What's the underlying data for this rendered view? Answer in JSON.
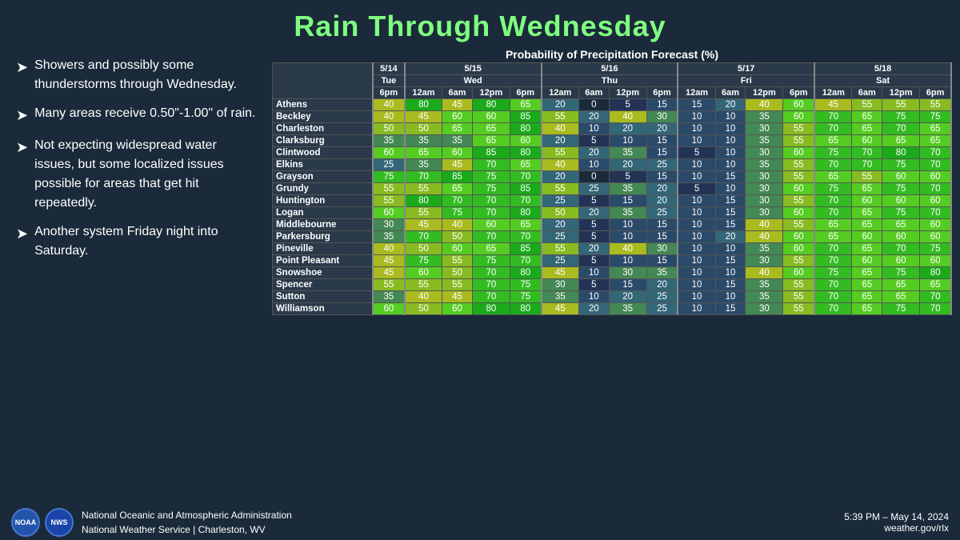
{
  "title": "Rain Through Wednesday",
  "bullets": [
    "Showers and possibly some thunderstorms through Wednesday.",
    "Many areas receive 0.50\"-1.00\" of rain.",
    "Not expecting widespread water issues, but some localized issues possible for areas that get hit repeatedly.",
    "Another system Friday night into Saturday."
  ],
  "table_title": "Probability of Precipitation Forecast (%)",
  "dates": [
    {
      "label": "5/14",
      "sub": "Tue",
      "cols": [
        "6pm"
      ]
    },
    {
      "label": "5/15",
      "sub": "Wed",
      "cols": [
        "12am",
        "6am",
        "12pm",
        "6pm"
      ]
    },
    {
      "label": "5/16",
      "sub": "Thu",
      "cols": [
        "12am",
        "6am",
        "12pm",
        "6pm"
      ]
    },
    {
      "label": "5/17",
      "sub": "Fri",
      "cols": [
        "12am",
        "6am",
        "12pm",
        "6pm"
      ]
    },
    {
      "label": "5/18",
      "sub": "Sat",
      "cols": [
        "12am",
        "6am",
        "12pm",
        "6pm"
      ]
    }
  ],
  "cities": [
    {
      "name": "Athens",
      "vals": [
        40,
        80,
        45,
        80,
        65,
        20,
        0,
        5,
        15,
        15,
        20,
        40,
        60,
        45,
        55,
        55,
        55
      ]
    },
    {
      "name": "Beckley",
      "vals": [
        40,
        45,
        60,
        60,
        85,
        55,
        20,
        40,
        30,
        10,
        10,
        35,
        60,
        70,
        65,
        75,
        75
      ]
    },
    {
      "name": "Charleston",
      "vals": [
        50,
        50,
        65,
        65,
        80,
        40,
        10,
        20,
        20,
        10,
        10,
        30,
        55,
        70,
        65,
        70,
        65
      ]
    },
    {
      "name": "Clarksburg",
      "vals": [
        35,
        35,
        35,
        65,
        60,
        20,
        5,
        10,
        15,
        10,
        10,
        35,
        55,
        65,
        60,
        65,
        65
      ]
    },
    {
      "name": "Clintwood",
      "vals": [
        60,
        65,
        60,
        85,
        80,
        55,
        20,
        35,
        15,
        5,
        10,
        30,
        60,
        75,
        70,
        80,
        70
      ]
    },
    {
      "name": "Elkins",
      "vals": [
        25,
        35,
        45,
        70,
        65,
        40,
        10,
        20,
        25,
        10,
        10,
        35,
        55,
        70,
        70,
        75,
        70
      ]
    },
    {
      "name": "Grayson",
      "vals": [
        75,
        70,
        85,
        75,
        70,
        20,
        0,
        5,
        15,
        10,
        15,
        30,
        55,
        65,
        55,
        60,
        60
      ]
    },
    {
      "name": "Grundy",
      "vals": [
        55,
        55,
        65,
        75,
        85,
        55,
        25,
        35,
        20,
        5,
        10,
        30,
        60,
        75,
        65,
        75,
        70
      ]
    },
    {
      "name": "Huntington",
      "vals": [
        55,
        80,
        70,
        70,
        70,
        25,
        5,
        15,
        20,
        10,
        15,
        30,
        55,
        70,
        60,
        60,
        60
      ]
    },
    {
      "name": "Logan",
      "vals": [
        60,
        55,
        75,
        70,
        80,
        50,
        20,
        35,
        25,
        10,
        15,
        30,
        60,
        70,
        65,
        75,
        70
      ]
    },
    {
      "name": "Middlebourne",
      "vals": [
        30,
        45,
        40,
        60,
        65,
        20,
        5,
        10,
        15,
        10,
        15,
        40,
        55,
        65,
        65,
        65,
        60
      ]
    },
    {
      "name": "Parkersburg",
      "vals": [
        35,
        70,
        50,
        70,
        70,
        25,
        5,
        10,
        15,
        10,
        20,
        40,
        60,
        65,
        60,
        60,
        60
      ]
    },
    {
      "name": "Pineville",
      "vals": [
        40,
        50,
        60,
        65,
        85,
        55,
        20,
        40,
        30,
        10,
        10,
        35,
        60,
        70,
        65,
        70,
        75
      ]
    },
    {
      "name": "Point Pleasant",
      "vals": [
        45,
        75,
        55,
        75,
        70,
        25,
        5,
        10,
        15,
        10,
        15,
        30,
        55,
        70,
        60,
        60,
        60
      ]
    },
    {
      "name": "Snowshoe",
      "vals": [
        45,
        60,
        50,
        70,
        80,
        45,
        10,
        30,
        35,
        10,
        10,
        40,
        60,
        75,
        65,
        75,
        80
      ]
    },
    {
      "name": "Spencer",
      "vals": [
        55,
        55,
        55,
        70,
        75,
        30,
        5,
        15,
        20,
        10,
        15,
        35,
        55,
        70,
        65,
        65,
        65
      ]
    },
    {
      "name": "Sutton",
      "vals": [
        35,
        40,
        45,
        70,
        75,
        35,
        10,
        20,
        25,
        10,
        10,
        35,
        55,
        70,
        65,
        65,
        70
      ]
    },
    {
      "name": "Williamson",
      "vals": [
        60,
        50,
        60,
        80,
        80,
        45,
        20,
        35,
        25,
        10,
        15,
        30,
        55,
        70,
        65,
        75,
        70
      ]
    }
  ],
  "footer": {
    "org_line1": "National Oceanic and Atmospheric Administration",
    "org_line2": "National Weather Service | Charleston, WV",
    "timestamp": "5:39 PM – May 14, 2024",
    "website": "weather.gov/rlx"
  }
}
